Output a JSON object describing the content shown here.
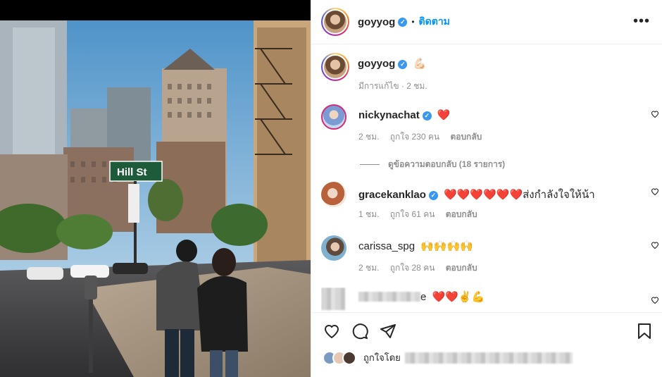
{
  "post": {
    "author": "goyyog",
    "follow_label": "ติดตาม",
    "separator": "•",
    "more_icon": "more-horizontal-icon",
    "street_sign": "Hill St"
  },
  "caption": {
    "username": "goyyog",
    "emoji": "💪🏻",
    "meta": "มีการแก้ไข · 2 ชม."
  },
  "comments": [
    {
      "username": "nickynachat",
      "text": "❤️",
      "time": "2 ชม.",
      "likes": "ถูกใจ 230 คน",
      "reply": "ตอบกลับ"
    },
    {
      "username": "gracekanklao",
      "text": "❤️❤️❤️❤️❤️❤️ส่งกำลังใจให้น้า",
      "time": "1 ชม.",
      "likes": "ถูกใจ 61 คน",
      "reply": "ตอบกลับ"
    },
    {
      "username": "carissa_spg",
      "text": "🙌🙌🙌🙌",
      "time": "2 ชม.",
      "likes": "ถูกใจ 28 คน",
      "reply": "ตอบกลับ"
    },
    {
      "username_suffix": "e",
      "text": "❤️❤️✌️💪"
    }
  ],
  "view_replies": "ดูข้อความตอบกลับ (18 รายการ)",
  "likes_prefix": "ถูกใจโดย",
  "colors": {
    "accent": "#0095f6",
    "verified": "#3897f0",
    "heart": "#ed4956",
    "muted": "#8e8e8e"
  }
}
